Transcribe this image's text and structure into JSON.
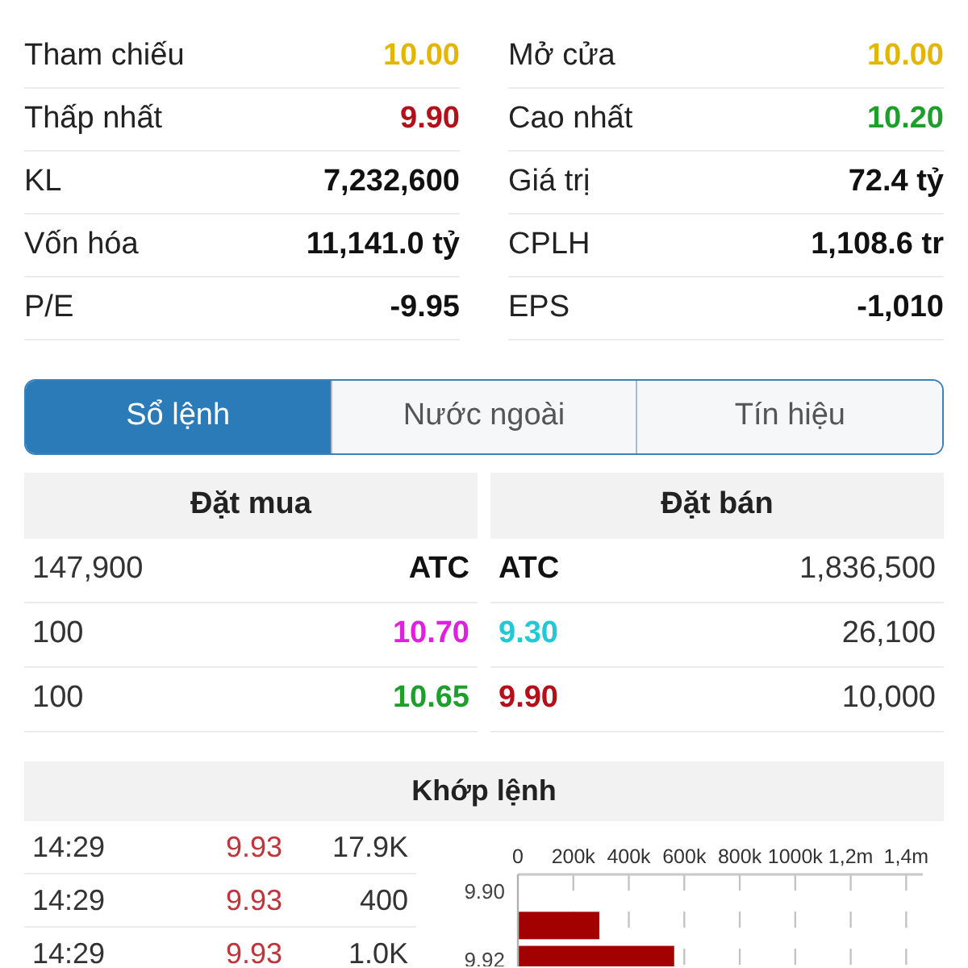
{
  "stat_columns": [
    {
      "items": [
        {
          "label": "Tham chiếu",
          "value": "10.00",
          "color": "#e3b505"
        },
        {
          "label": "Thấp nhất",
          "value": "9.90",
          "color": "#b3101a"
        },
        {
          "label": "KL",
          "value": "7,232,600",
          "color": "#111111"
        },
        {
          "label": "Vốn hóa",
          "value": "11,141.0 tỷ",
          "color": "#111111"
        },
        {
          "label": "P/E",
          "value": "-9.95",
          "color": "#111111"
        }
      ]
    },
    {
      "items": [
        {
          "label": "Mở cửa",
          "value": "10.00",
          "color": "#e3b505"
        },
        {
          "label": "Cao nhất",
          "value": "10.20",
          "color": "#1e9e2a"
        },
        {
          "label": "Giá trị",
          "value": "72.4 tỷ",
          "color": "#111111"
        },
        {
          "label": "CPLH",
          "value": "1,108.6 tr",
          "color": "#111111"
        },
        {
          "label": "EPS",
          "value": "-1,010",
          "color": "#111111"
        }
      ]
    }
  ],
  "tabs": [
    {
      "label": "Sổ lệnh",
      "selected": true
    },
    {
      "label": "Nước ngoài",
      "selected": false
    },
    {
      "label": "Tín hiệu",
      "selected": false
    }
  ],
  "order_book": {
    "bid_title": "Đặt mua",
    "ask_title": "Đặt bán",
    "rows": [
      {
        "bid": {
          "volume": "147,900",
          "price": "ATC",
          "color": "#111111"
        },
        "ask": {
          "price": "ATC",
          "color": "#111111",
          "volume": "1,836,500"
        }
      },
      {
        "bid": {
          "volume": "100",
          "price": "10.70",
          "color": "#e020e0"
        },
        "ask": {
          "price": "9.30",
          "color": "#22c8d2",
          "volume": "26,100"
        }
      },
      {
        "bid": {
          "volume": "100",
          "price": "10.65",
          "color": "#1e9e2a"
        },
        "ask": {
          "price": "9.90",
          "color": "#b3101a",
          "volume": "10,000"
        }
      }
    ]
  },
  "matching": {
    "title": "Khớp lệnh",
    "trades": [
      {
        "time": "14:29",
        "price": "9.93",
        "volume": "17.9K"
      },
      {
        "time": "14:29",
        "price": "9.93",
        "volume": "400"
      },
      {
        "time": "14:29",
        "price": "9.93",
        "volume": "1.0K"
      }
    ],
    "chart_data": {
      "type": "bar",
      "orientation": "horizontal",
      "x": [
        9.91,
        9.92
      ],
      "values": [
        290000,
        560000
      ],
      "xlim": [
        0,
        1460000
      ],
      "ylim": [
        9.922,
        9.895
      ],
      "grid": true,
      "xticks": [
        {
          "value": 0,
          "label": "0"
        },
        {
          "value": 200000,
          "label": "200k"
        },
        {
          "value": 400000,
          "label": "400k"
        },
        {
          "value": 600000,
          "label": "600k"
        },
        {
          "value": 800000,
          "label": "800k"
        },
        {
          "value": 1000000,
          "label": "1000k"
        },
        {
          "value": 1200000,
          "label": "1,2m"
        },
        {
          "value": 1400000,
          "label": "1,4m"
        }
      ],
      "yticks": [
        {
          "value": 9.9,
          "label": "9.90"
        },
        {
          "value": 9.92,
          "label": "9.92"
        }
      ]
    }
  }
}
